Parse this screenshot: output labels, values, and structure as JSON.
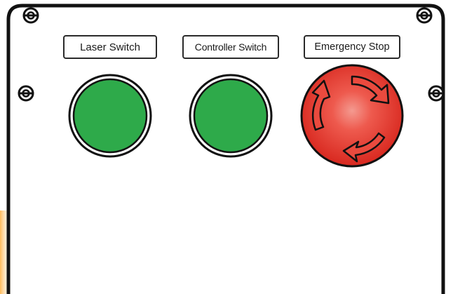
{
  "panel": {
    "labels": {
      "laser_switch": "Laser Switch",
      "controller_switch": "Controller Switch",
      "emergency_stop": "Emergency Stop"
    },
    "colors": {
      "panel_outline": "#111111",
      "green_button": "#2eaa4a",
      "red_button": "#e03a34",
      "accent_stripe": "#f5a623"
    },
    "icons": [
      "screw-icon",
      "rotate-arrow-icon"
    ]
  }
}
